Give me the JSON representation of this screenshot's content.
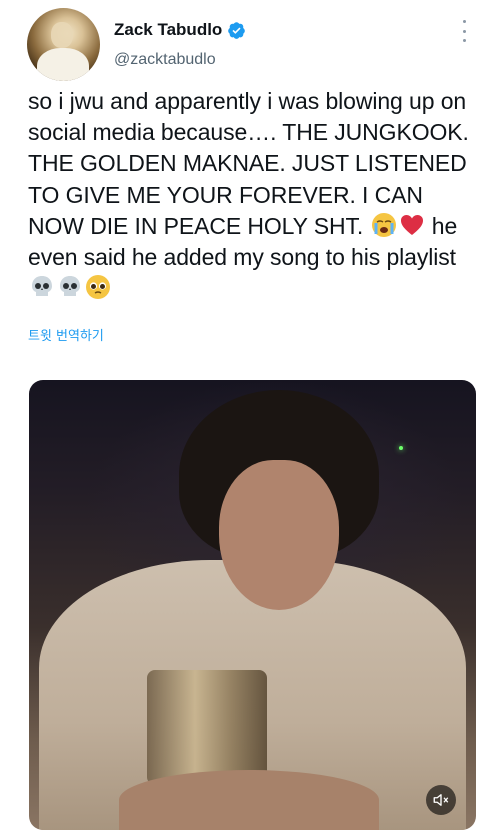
{
  "tweet": {
    "author_name": "Zack Tabudlo",
    "author_handle": "@zacktabudlo",
    "verified": true,
    "text_part1": "so i jwu and apparently i was blowing up on social media because…. THE JUNGKOOK. THE GOLDEN MAKNAE. JUST LISTENED TO GIVE ME YOUR FOREVER. I CAN NOW DIE IN PEACE HOLY SHT. ",
    "text_part2": " he even said he added my song to his playlist ",
    "translate_label": "트윗 번역하기"
  },
  "icons": {
    "verified": "verified-badge-icon",
    "more": "more-options-icon",
    "mute": "volume-muted-icon",
    "emojis": [
      "crying-face-emoji",
      "red-heart-emoji",
      "skull-emoji",
      "skull-emoji",
      "pleading-face-emoji"
    ]
  },
  "colors": {
    "accent": "#1d9bf0",
    "text": "#0f1419",
    "secondary": "#536471"
  }
}
